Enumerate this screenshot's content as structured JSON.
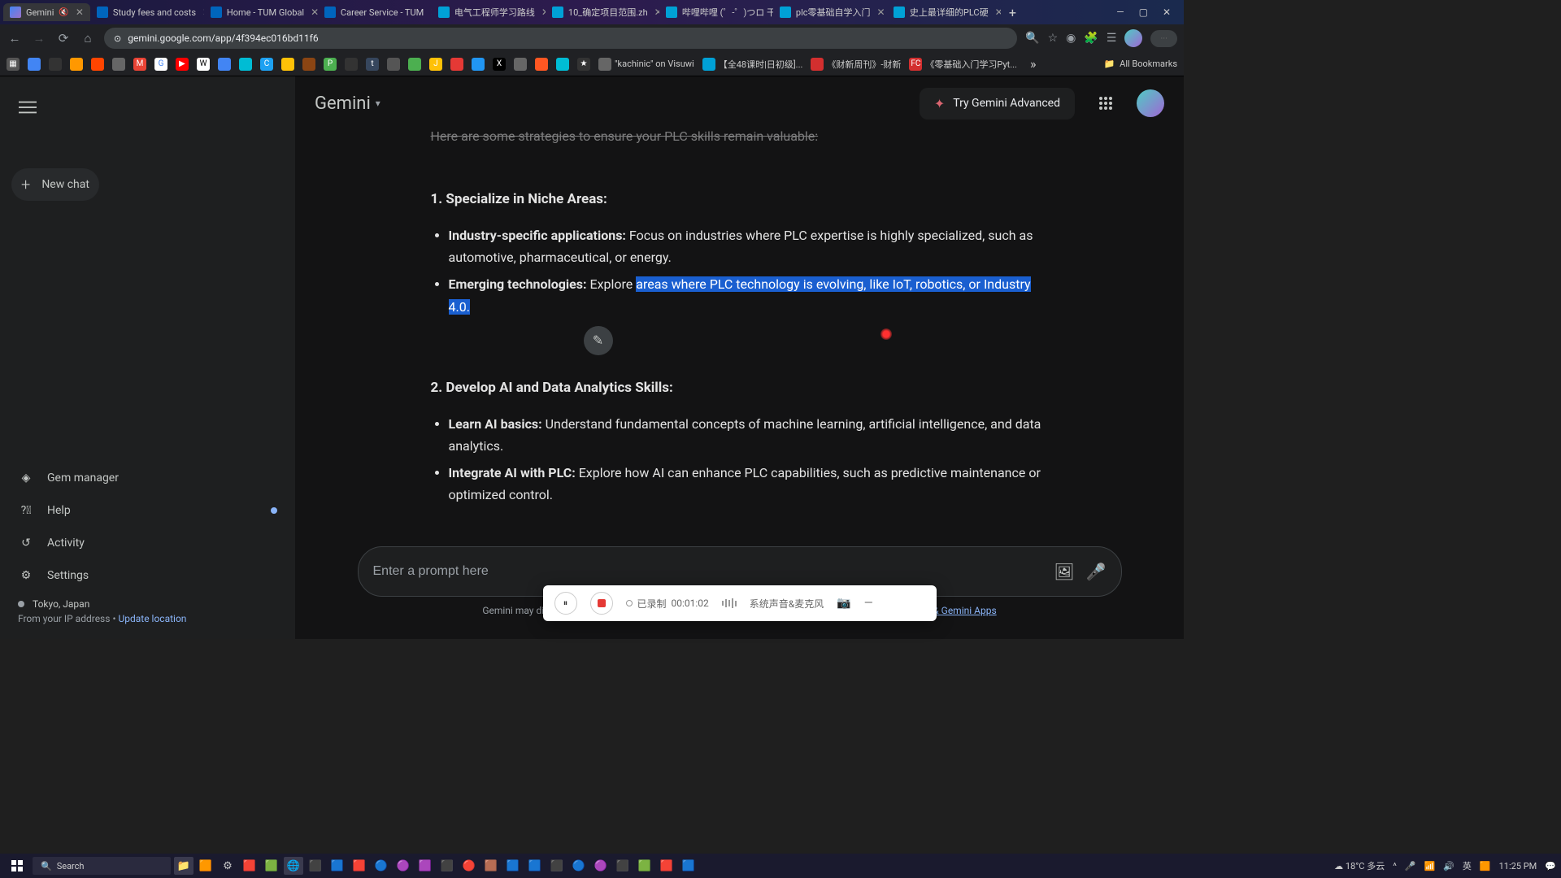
{
  "browser": {
    "tabs": [
      {
        "label": "Gemini",
        "active": true
      },
      {
        "label": "Study fees and costs"
      },
      {
        "label": "Home - TUM Global"
      },
      {
        "label": "Career Service - TUM"
      },
      {
        "label": "电气工程师学习路线"
      },
      {
        "label": "10_确定项目范围.zh"
      },
      {
        "label": "哔哩哔哩 (゜-゜)つロ 干"
      },
      {
        "label": "plc零基础自学入门"
      },
      {
        "label": "史上最详细的PLC硬"
      }
    ],
    "url": "gemini.google.com/app/4f394ec016bd11f6",
    "bookmarks": {
      "named": [
        {
          "label": "\"kachinic\" on Visuwi"
        },
        {
          "label": "【全48课时|日初级]..."
        },
        {
          "label": "《财新周刊》-财新"
        },
        {
          "label": "《零基础入门学习Pyt..."
        }
      ],
      "all": "All Bookmarks"
    },
    "window": {
      "min": "—",
      "max": "▢",
      "close": "✕"
    }
  },
  "sidebar": {
    "new_chat": "New chat",
    "items": {
      "gem": "Gem manager",
      "help": "Help",
      "activity": "Activity",
      "settings": "Settings"
    },
    "location": {
      "name": "Tokyo, Japan",
      "ip_text": "From your IP address",
      "update": "Update location"
    }
  },
  "header": {
    "brand": "Gemini",
    "try_advanced": "Try Gemini Advanced"
  },
  "content": {
    "cut_line": "Here are some strategies to ensure your PLC skills remain valuable:",
    "section1": {
      "heading": "1. Specialize in Niche Areas:",
      "bullets": [
        {
          "strong": "Industry-specific applications:",
          "text": " Focus on industries where PLC expertise is highly specialized, such as automotive, pharmaceutical, or energy."
        },
        {
          "strong": "Emerging technologies:",
          "pre": " Explore ",
          "hl": "areas where PLC technology is evolving, like IoT, robotics, or Industry 4.0."
        }
      ]
    },
    "section2": {
      "heading": "2. Develop AI and Data Analytics Skills:",
      "bullets": [
        {
          "strong": "Learn AI basics:",
          "text": " Understand fundamental concepts of machine learning, artificial intelligence, and data analytics."
        },
        {
          "strong": "Integrate AI with PLC:",
          "text": " Explore how AI can enhance PLC capabilities, such as predictive maintenance or optimized control."
        }
      ]
    }
  },
  "input": {
    "placeholder": "Enter a prompt here"
  },
  "disclaimer": {
    "text_prefix": "Gemini may display inaccurate info, including about people, so double-check its responses. ",
    "link": "Your privacy & Gemini Apps"
  },
  "recorder": {
    "status": "已录制",
    "time": "00:01:02",
    "source": "系统声音&麦克风"
  },
  "taskbar": {
    "search": "Search",
    "weather": "18°C 多云",
    "time": "11:25 PM"
  }
}
